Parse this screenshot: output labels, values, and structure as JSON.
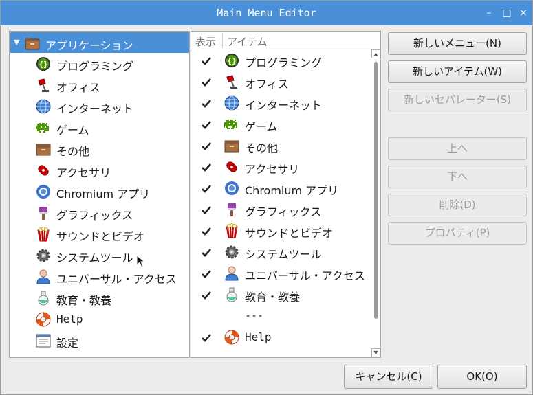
{
  "window": {
    "title": "Main Menu Editor",
    "controls": {
      "minimize": "–",
      "maximize": "□",
      "close": "×"
    }
  },
  "tree": {
    "root": {
      "label": "アプリケーション",
      "icon": "folder-icon"
    },
    "items": [
      {
        "label": "プログラミング",
        "icon": "programming-icon"
      },
      {
        "label": "オフィス",
        "icon": "office-lamp-icon"
      },
      {
        "label": "インターネット",
        "icon": "globe-icon"
      },
      {
        "label": "ゲーム",
        "icon": "game-invader-icon"
      },
      {
        "label": "その他",
        "icon": "box-icon"
      },
      {
        "label": "アクセサリ",
        "icon": "swiss-knife-icon"
      },
      {
        "label": "Chromium アプリ",
        "icon": "chromium-icon"
      },
      {
        "label": "グラフィックス",
        "icon": "paintbrush-icon"
      },
      {
        "label": "サウンドとビデオ",
        "icon": "popcorn-icon"
      },
      {
        "label": "システムツール",
        "icon": "gear-icon"
      },
      {
        "label": "ユニバーサル・アクセス",
        "icon": "person-icon"
      },
      {
        "label": "教育・教養",
        "icon": "flask-icon"
      },
      {
        "label": "Help",
        "icon": "lifebuoy-icon"
      },
      {
        "label": "設定",
        "icon": "settings-panel-icon"
      }
    ]
  },
  "list": {
    "headers": {
      "show": "表示",
      "item": "アイテム"
    },
    "rows": [
      {
        "checked": true,
        "label": "プログラミング",
        "icon": "programming-icon"
      },
      {
        "checked": true,
        "label": "オフィス",
        "icon": "office-lamp-icon"
      },
      {
        "checked": true,
        "label": "インターネット",
        "icon": "globe-icon"
      },
      {
        "checked": true,
        "label": "ゲーム",
        "icon": "game-invader-icon"
      },
      {
        "checked": true,
        "label": "その他",
        "icon": "box-icon"
      },
      {
        "checked": true,
        "label": "アクセサリ",
        "icon": "swiss-knife-icon"
      },
      {
        "checked": true,
        "label": "Chromium アプリ",
        "icon": "chromium-icon"
      },
      {
        "checked": true,
        "label": "グラフィックス",
        "icon": "paintbrush-icon"
      },
      {
        "checked": true,
        "label": "サウンドとビデオ",
        "icon": "popcorn-icon"
      },
      {
        "checked": true,
        "label": "システムツール",
        "icon": "gear-icon"
      },
      {
        "checked": true,
        "label": "ユニバーサル・アクセス",
        "icon": "person-icon"
      },
      {
        "checked": true,
        "label": "教育・教養",
        "icon": "flask-icon"
      },
      {
        "separator": "---"
      },
      {
        "checked": true,
        "label": "Help",
        "icon": "lifebuoy-icon"
      }
    ]
  },
  "buttons": {
    "new_menu": "新しいメニュー(N)",
    "new_item": "新しいアイテム(W)",
    "new_separator": "新しいセパレーター(S)",
    "move_up": "上へ",
    "move_down": "下へ",
    "delete": "削除(D)",
    "properties": "プロパティ(P)",
    "cancel": "キャンセル(C)",
    "ok": "OK(O)"
  },
  "colors": {
    "accent": "#4a90d9",
    "titlebar": "#4a90d9"
  }
}
